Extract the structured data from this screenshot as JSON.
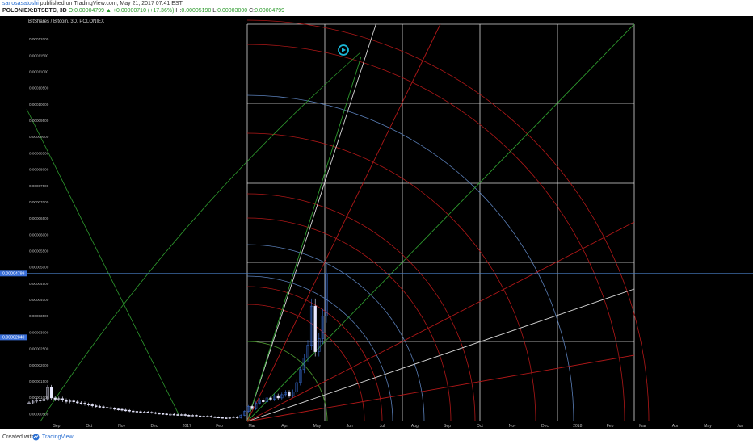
{
  "header": {
    "author": "sanosasatoshi",
    "published": "published on TradingView.com, May 21, 2017 07:41 EST",
    "symbol": "POLONIEX:BTSBTC, 3D",
    "open_label": "O:",
    "open": "0.00004799",
    "change": "▲ +0.00000710 (+17.36%)",
    "high_label": "H:",
    "high": "0.00005190",
    "low_label": "L:",
    "low": "0.00003000",
    "close_label": "C:",
    "close": "0.00004799"
  },
  "footer": {
    "created_with": "Created with",
    "brand": "TradingView"
  },
  "chart_data": {
    "type": "candlestick",
    "title": "BitShares / Bitcoin, 3D, POLONIEX",
    "y_ticks": [
      "0.00000500",
      "0.00001000",
      "0.00001500",
      "0.00002000",
      "0.00002500",
      "0.00003000",
      "0.00003500",
      "0.00004000",
      "0.00004500",
      "0.00005000",
      "0.00005500",
      "0.00006000",
      "0.00006500",
      "0.00007000",
      "0.00007500",
      "0.00008000",
      "0.00008500",
      "0.00009000",
      "0.00009500",
      "0.00010000",
      "0.00010500",
      "0.00011000",
      "0.00011500",
      "0.00012000"
    ],
    "ylim": [
      2.6e-06,
      0.0001245
    ],
    "x_ticks": [
      "Sep",
      "Oct",
      "Nov",
      "Dec",
      "2017",
      "Feb",
      "Mar",
      "Apr",
      "May",
      "Jun",
      "Jul",
      "Aug",
      "Sep",
      "Oct",
      "Nov",
      "Dec",
      "2018",
      "Feb",
      "Mar",
      "Apr",
      "May",
      "Jun"
    ],
    "last_price_label": "0.00004799",
    "last_price": 4.799e-05,
    "secondary_label": "0.00002840",
    "secondary_price": 2.84e-05,
    "colors": {
      "background": "#000000",
      "candle": "#e8e8ff",
      "candle_rise": "#3a6fd8",
      "gann_white": "#cfcfcf",
      "gann_red": "#b01818",
      "gann_blue": "#5a7fb8",
      "gann_green": "#2e9a2e",
      "price_line": "#4a80c8"
    },
    "candles_closes": [
      8.3e-06,
      8.8e-06,
      9.2e-06,
      8.9e-06,
      9.5e-06,
      1.3e-05,
      9.8e-06,
      9.4e-06,
      9.6e-06,
      9.1e-06,
      8.7e-06,
      8.9e-06,
      8.6e-06,
      8.3e-06,
      8.2e-06,
      7.9e-06,
      7.7e-06,
      7.4e-06,
      7.2e-06,
      7.1e-06,
      6.9e-06,
      6.8e-06,
      6.6e-06,
      6.4e-06,
      6.3e-06,
      6.1e-06,
      6e-06,
      5.8e-06,
      5.7e-06,
      5.6e-06,
      5.5e-06,
      5.5e-06,
      5.4e-06,
      5.3e-06,
      5.1e-06,
      5e-06,
      4.9e-06,
      4.8e-06,
      4.8e-06,
      4.7e-06,
      4.6e-06,
      4.7e-06,
      4.5e-06,
      4.4e-06,
      4.5e-06,
      4.3e-06,
      4.2e-06,
      4.1e-06,
      4.2e-06,
      4e-06,
      3.9e-06,
      3.8e-06,
      3.7e-06,
      3.6e-06,
      3.8e-06,
      4e-06,
      3.7e-06,
      4.5e-06,
      5.7e-06,
      7.2e-06,
      6.5e-06,
      8.2e-06,
      9.2e-06,
      8.6e-06,
      9.8e-06,
      9.4e-06,
      1.05e-05,
      9.8e-06,
      1.08e-05,
      1.15e-05,
      1.05e-05,
      1.17e-05,
      1.45e-05,
      1.85e-05,
      2.2e-05,
      2.6e-05,
      3.8e-05,
      2.4e-05,
      2.8e-05,
      3.5e-05,
      4.799e-05
    ]
  }
}
